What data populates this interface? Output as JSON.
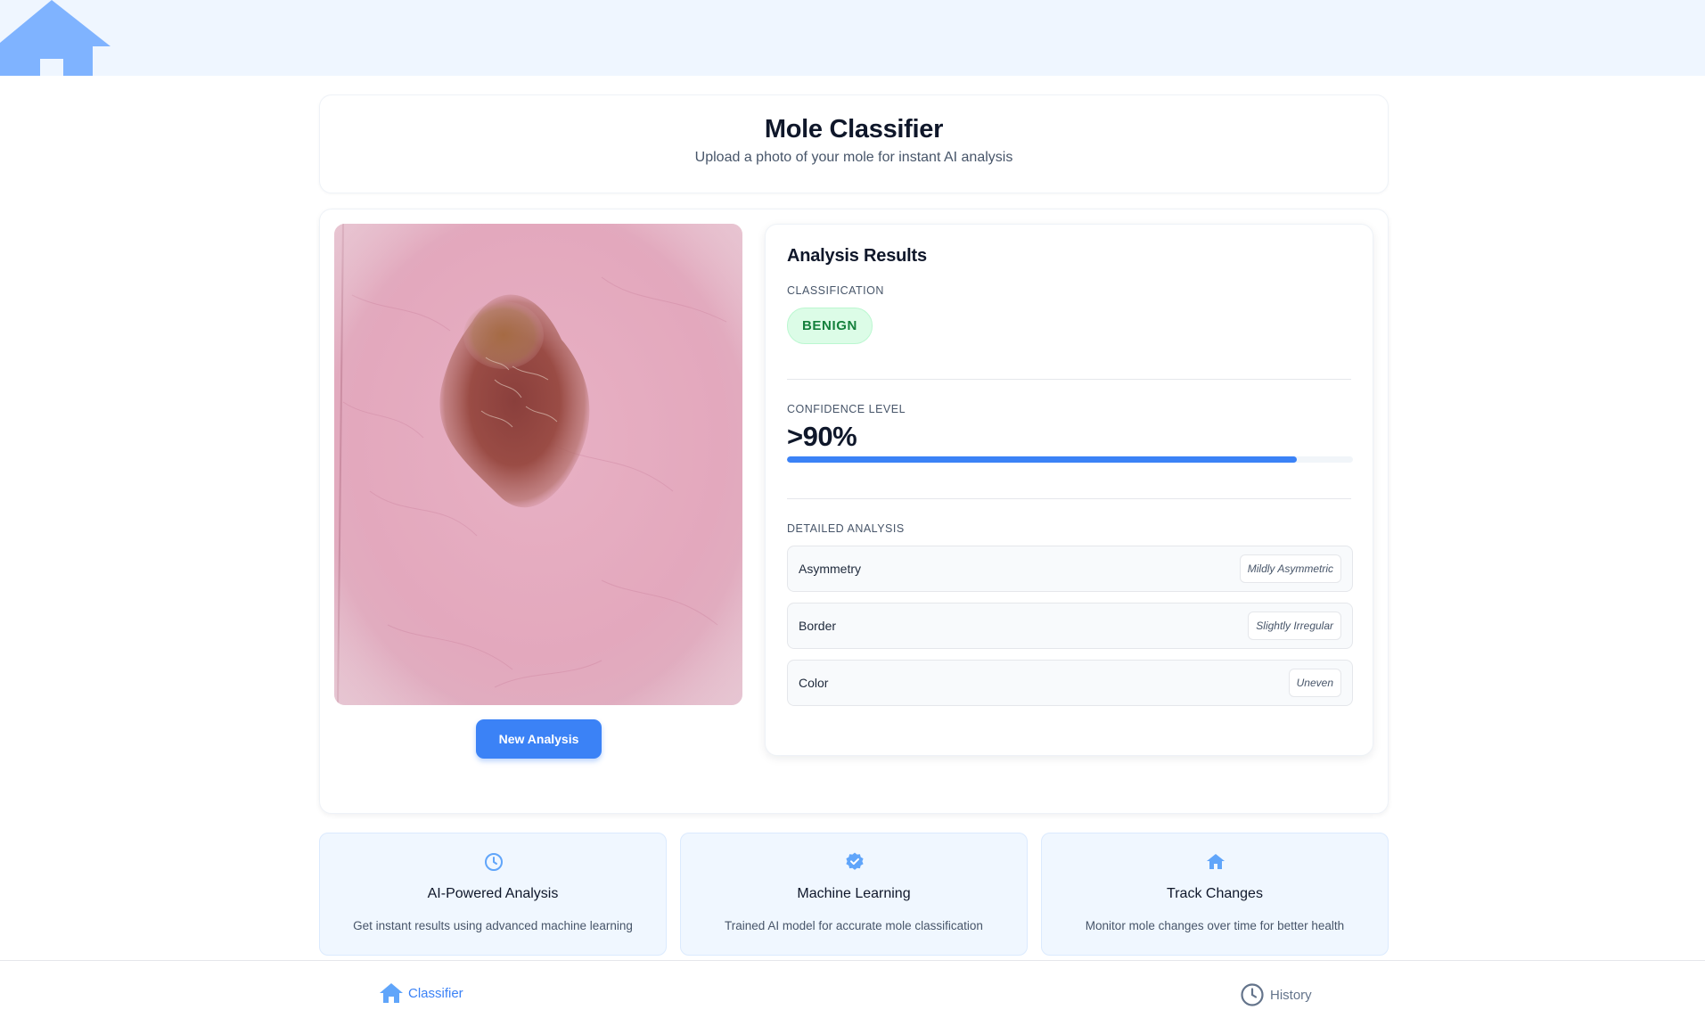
{
  "app": {
    "title": "Mole Classifier",
    "subtitle": "Upload a photo of your mole for instant AI analysis"
  },
  "colors": {
    "accent": "#3b82f6",
    "benign_bg": "#dcfce7",
    "benign_text": "#15803d",
    "topbar": "#eff6ff"
  },
  "upload": {
    "image_icon": "mole-photo",
    "new_analysis_label": "New Analysis"
  },
  "results": {
    "title": "Analysis Results",
    "classification_label": "CLASSIFICATION",
    "classification_value": "BENIGN",
    "confidence_label": "CONFIDENCE LEVEL",
    "confidence_value": ">90%",
    "confidence_fraction": 0.9,
    "detailed_label": "DETAILED ANALYSIS",
    "details": [
      {
        "label": "Asymmetry",
        "value": "Mildly Asymmetric"
      },
      {
        "label": "Border",
        "value": "Slightly Irregular"
      },
      {
        "label": "Color",
        "value": "Uneven"
      }
    ]
  },
  "features": [
    {
      "icon": "clock-icon",
      "title": "AI-Powered Analysis",
      "description": "Get instant results using advanced machine learning"
    },
    {
      "icon": "verified-badge-icon",
      "title": "Machine Learning",
      "description": "Trained AI model for accurate mole classification"
    },
    {
      "icon": "home-icon",
      "title": "Track Changes",
      "description": "Monitor mole changes over time for better health"
    }
  ],
  "nav": {
    "classifier_label": "Classifier",
    "history_label": "History"
  }
}
